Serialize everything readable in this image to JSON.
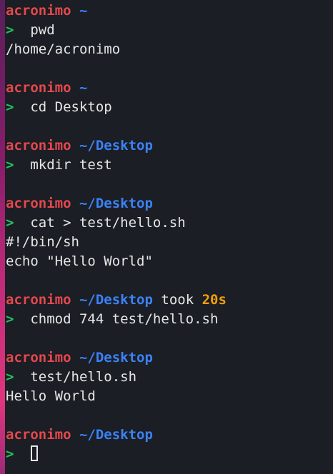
{
  "terminal": {
    "blocks": [
      {
        "user": "acronimo",
        "path": "~",
        "command": "pwd",
        "output": [
          "/home/acronimo"
        ]
      },
      {
        "user": "acronimo",
        "path": "~",
        "command": "cd Desktop",
        "output": []
      },
      {
        "user": "acronimo",
        "path": "~/Desktop",
        "command": "mkdir test",
        "output": []
      },
      {
        "user": "acronimo",
        "path": "~/Desktop",
        "command": "cat > test/hello.sh",
        "output": [
          "#!/bin/sh",
          "echo \"Hello World\""
        ]
      },
      {
        "user": "acronimo",
        "path": "~/Desktop",
        "took_label": "took",
        "duration": "20s",
        "command": "chmod 744 test/hello.sh",
        "output": []
      },
      {
        "user": "acronimo",
        "path": "~/Desktop",
        "command": "test/hello.sh",
        "output": [
          "Hello World"
        ]
      },
      {
        "user": "acronimo",
        "path": "~/Desktop",
        "command": "",
        "output": []
      }
    ],
    "prompt_symbol": ">",
    "colors": {
      "background": "#1b1e24",
      "user": "#e5484d",
      "path": "#3b82f6",
      "prompt": "#22c55e",
      "duration": "#f59e0b",
      "text": "#e6e6e6"
    }
  }
}
